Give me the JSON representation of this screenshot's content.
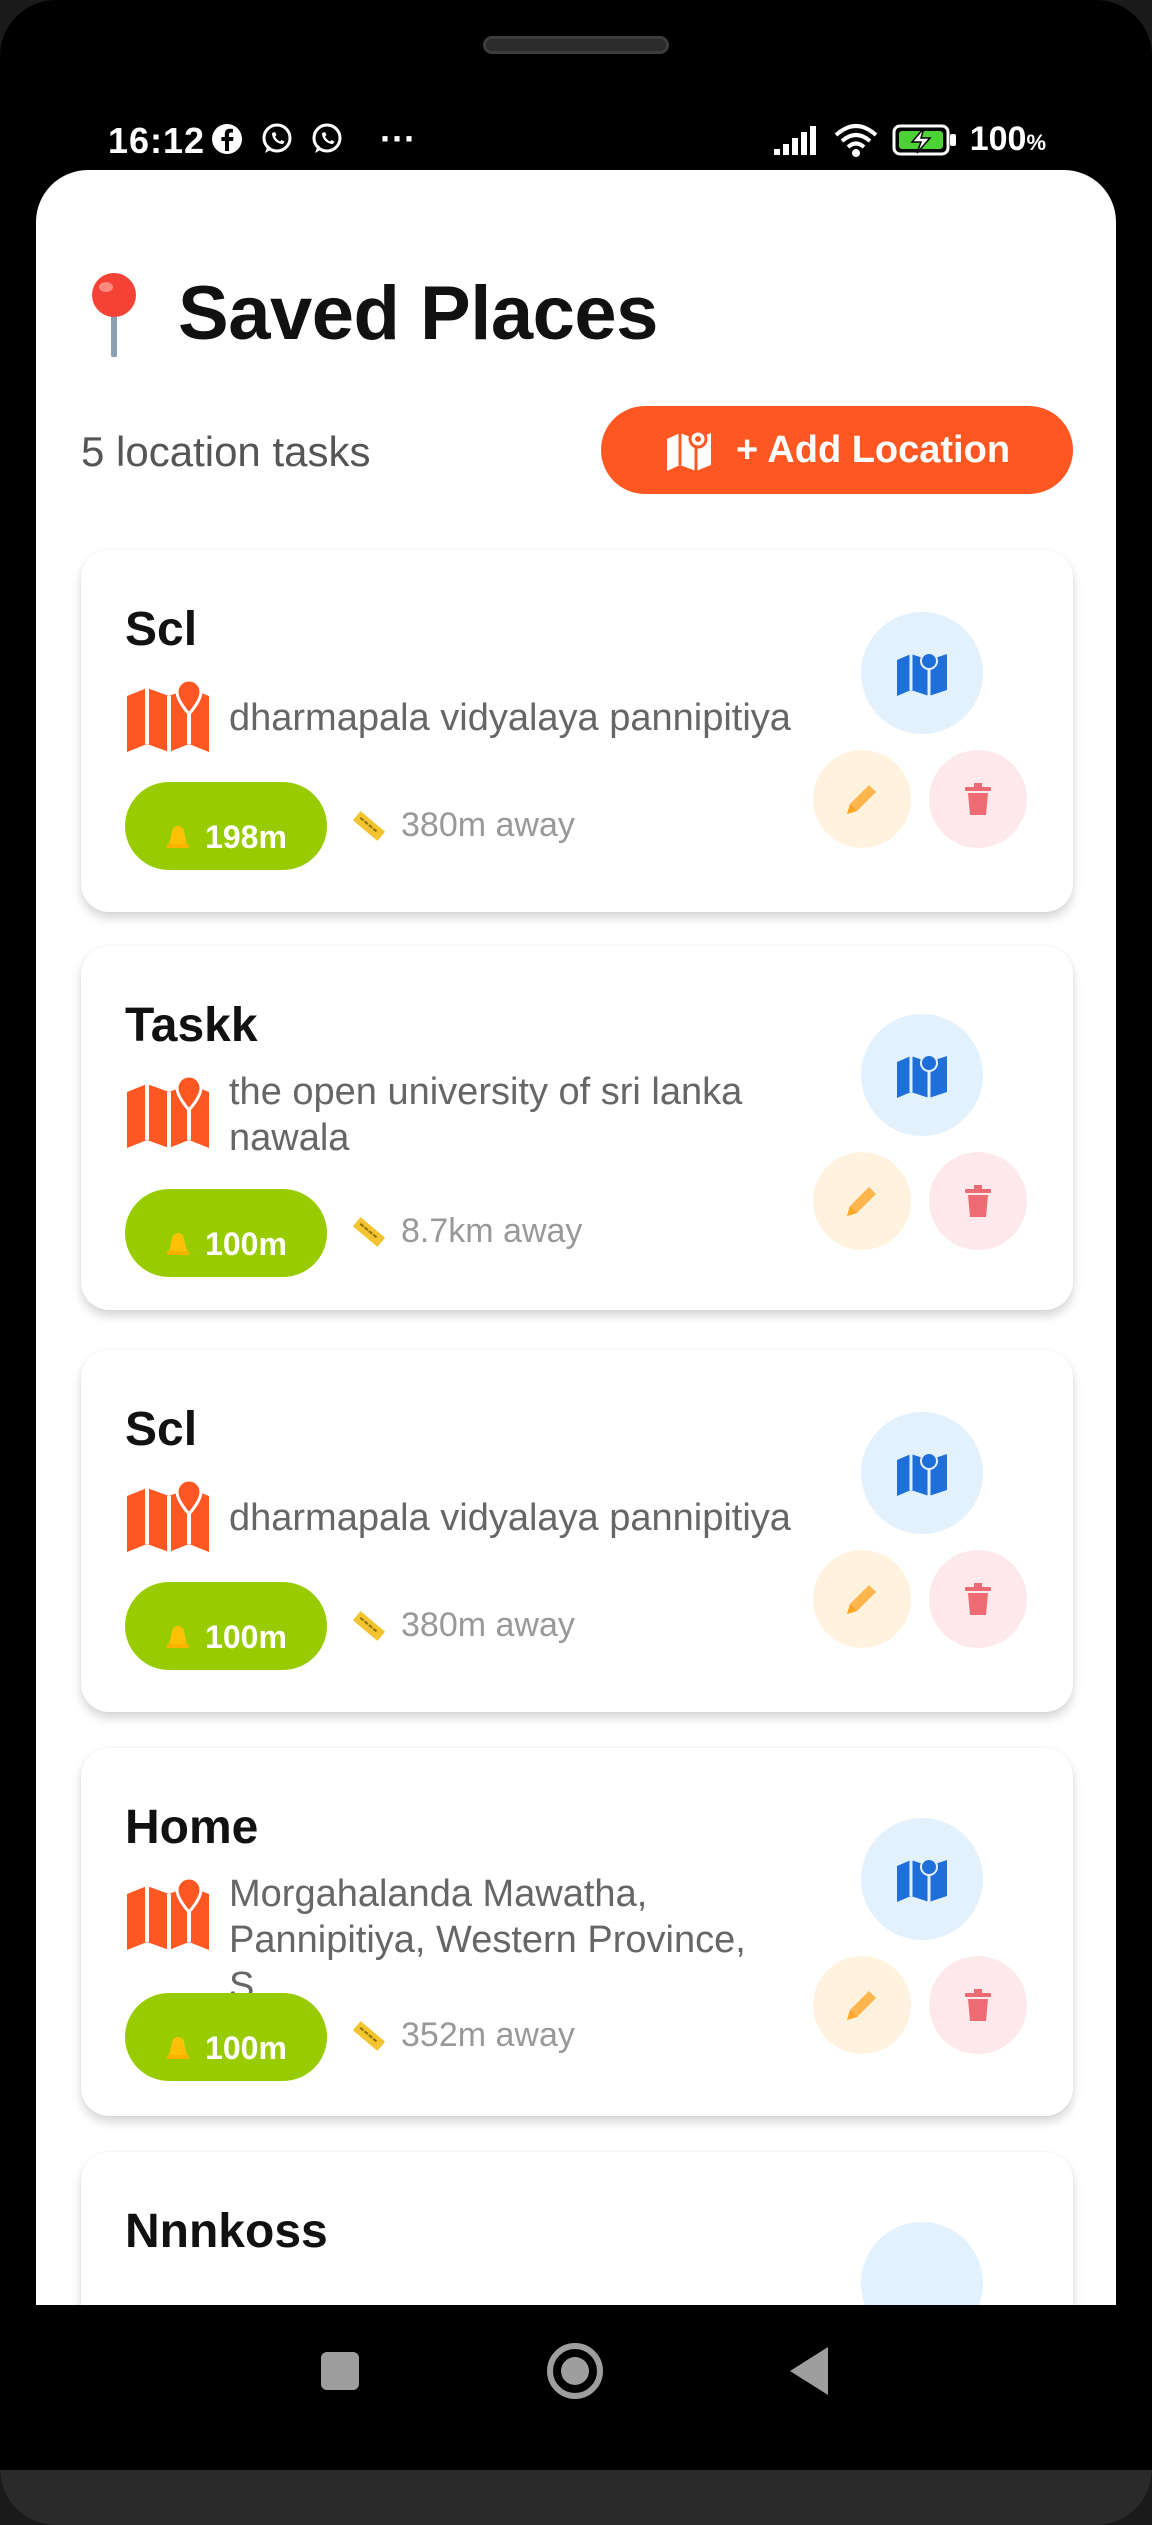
{
  "status_bar": {
    "time": "16:12",
    "battery_percent": "100",
    "battery_unit": "%",
    "left_icons": [
      "facebook-icon",
      "whatsapp-icon",
      "whatsapp-icon"
    ],
    "more": "···"
  },
  "header": {
    "title": "Saved Places",
    "task_count": "5 location tasks",
    "add_button_label": "+ Add Location"
  },
  "colors": {
    "accent": "#ff5722",
    "radius_pill": "#99cc00",
    "map_button_bg": "#e3f1fd",
    "edit_button_bg": "#fff3e0",
    "delete_button_bg": "#fde9ec"
  },
  "cards": [
    {
      "title": "Scl",
      "address": "dharmapala vidyalaya pannipitiya",
      "radius": "198m",
      "distance": "380m away"
    },
    {
      "title": "Taskk",
      "address": "the open university of sri lanka nawala",
      "radius": "100m",
      "distance": "8.7km away"
    },
    {
      "title": "Scl",
      "address": "dharmapala vidyalaya pannipitiya",
      "radius": "100m",
      "distance": "380m away"
    },
    {
      "title": "Home",
      "address": "Morgahalanda Mawatha, Pannipitiya, Western Province, S…",
      "radius": "100m",
      "distance": "352m away"
    },
    {
      "title": "Nnnkoss"
    }
  ]
}
